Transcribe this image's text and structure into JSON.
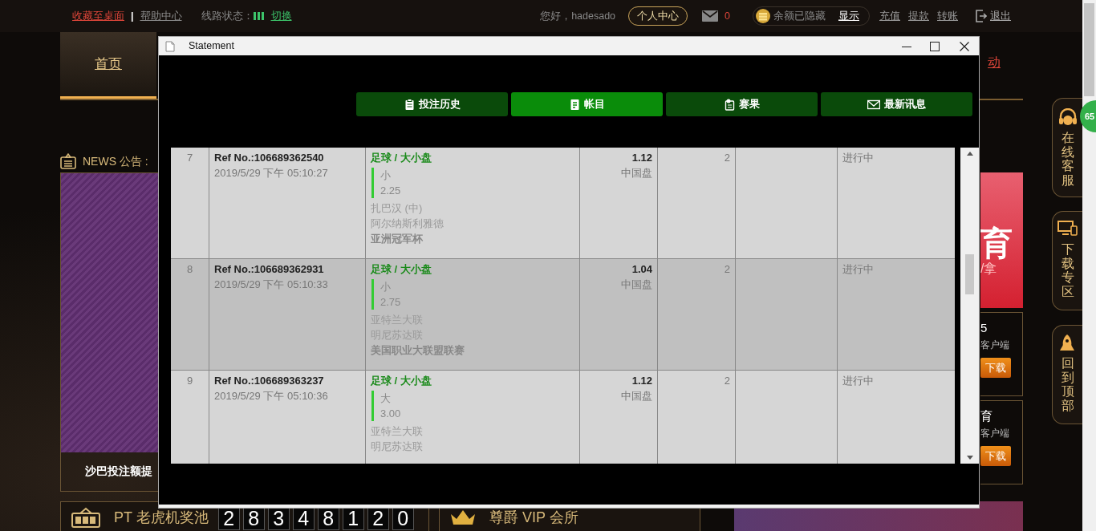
{
  "topbar": {
    "links": [
      {
        "label": "收藏至桌面",
        "kind": "highlight"
      },
      {
        "label": "帮助中心",
        "kind": "plain"
      }
    ],
    "separator": "|",
    "line_status": {
      "label": "线路状态：",
      "switch": "切换"
    },
    "greeting": "您好，hadesado",
    "profile_button": "个人中心",
    "mail_count": "0",
    "balance": {
      "text": "余额已隐藏",
      "toggle": "显示"
    },
    "actions": [
      "充值",
      "提款",
      "转账"
    ],
    "logout": "退出"
  },
  "nav": {
    "items": [
      {
        "label": "首页",
        "selected": true
      },
      {
        "label": "动",
        "selected": false
      }
    ]
  },
  "news": {
    "label": "NEWS 公告 :"
  },
  "promo": {
    "caption": "沙巴投注额提"
  },
  "right_banner": {
    "title": "育",
    "subtitle": "/拿"
  },
  "app_cards": [
    {
      "title": "5",
      "subtitle": "客户端",
      "button": "下载"
    },
    {
      "title": "育",
      "subtitle": "客户端",
      "button": "下载"
    }
  ],
  "float_menu": [
    {
      "label": "在线客服",
      "kind": "support"
    },
    {
      "label": "下载专区",
      "kind": "download"
    },
    {
      "label": "回到顶部",
      "kind": "top"
    }
  ],
  "float_badge": "65",
  "jackpot": {
    "label": "PT 老虎机奖池",
    "digits": [
      "2",
      "8",
      "3",
      "4",
      "8",
      "1",
      "2",
      "0"
    ]
  },
  "vip": {
    "label": "尊爵 VIP 会所"
  },
  "window": {
    "title": "Statement",
    "tabs": [
      {
        "label": "投注历史",
        "selected": false
      },
      {
        "label": "帐目",
        "selected": true
      },
      {
        "label": "赛果",
        "selected": false
      },
      {
        "label": "最新讯息",
        "selected": false
      }
    ],
    "rows": [
      {
        "no": "7",
        "ref": "Ref No.:106689362540",
        "time": "2019/5/29 下午 05:10:27",
        "sport": "足球 / 大小盘",
        "pick": "小",
        "line": "2.25",
        "teams": [
          "扎巴汉 (中)",
          "阿尔纳斯利雅德"
        ],
        "league": "亚洲冠军杯",
        "odds": "1.12",
        "odds_type": "中国盘",
        "stake": "2",
        "status": "进行中",
        "highlighted": false
      },
      {
        "no": "8",
        "ref": "Ref No.:106689362931",
        "time": "2019/5/29 下午 05:10:33",
        "sport": "足球 / 大小盘",
        "pick": "小",
        "line": "2.75",
        "teams": [
          "亚特兰大联",
          "明尼苏达联"
        ],
        "league": "美国职业大联盟联赛",
        "odds": "1.04",
        "odds_type": "中国盘",
        "stake": "2",
        "status": "进行中",
        "highlighted": true
      },
      {
        "no": "9",
        "ref": "Ref No.:106689363237",
        "time": "2019/5/29 下午 05:10:36",
        "sport": "足球 / 大小盘",
        "pick": "大",
        "line": "3.00",
        "teams": [
          "亚特兰大联",
          "明尼苏达联"
        ],
        "odds": "1.12",
        "odds_type": "中国盘",
        "stake": "2",
        "status": "进行中",
        "highlighted": false
      }
    ]
  }
}
